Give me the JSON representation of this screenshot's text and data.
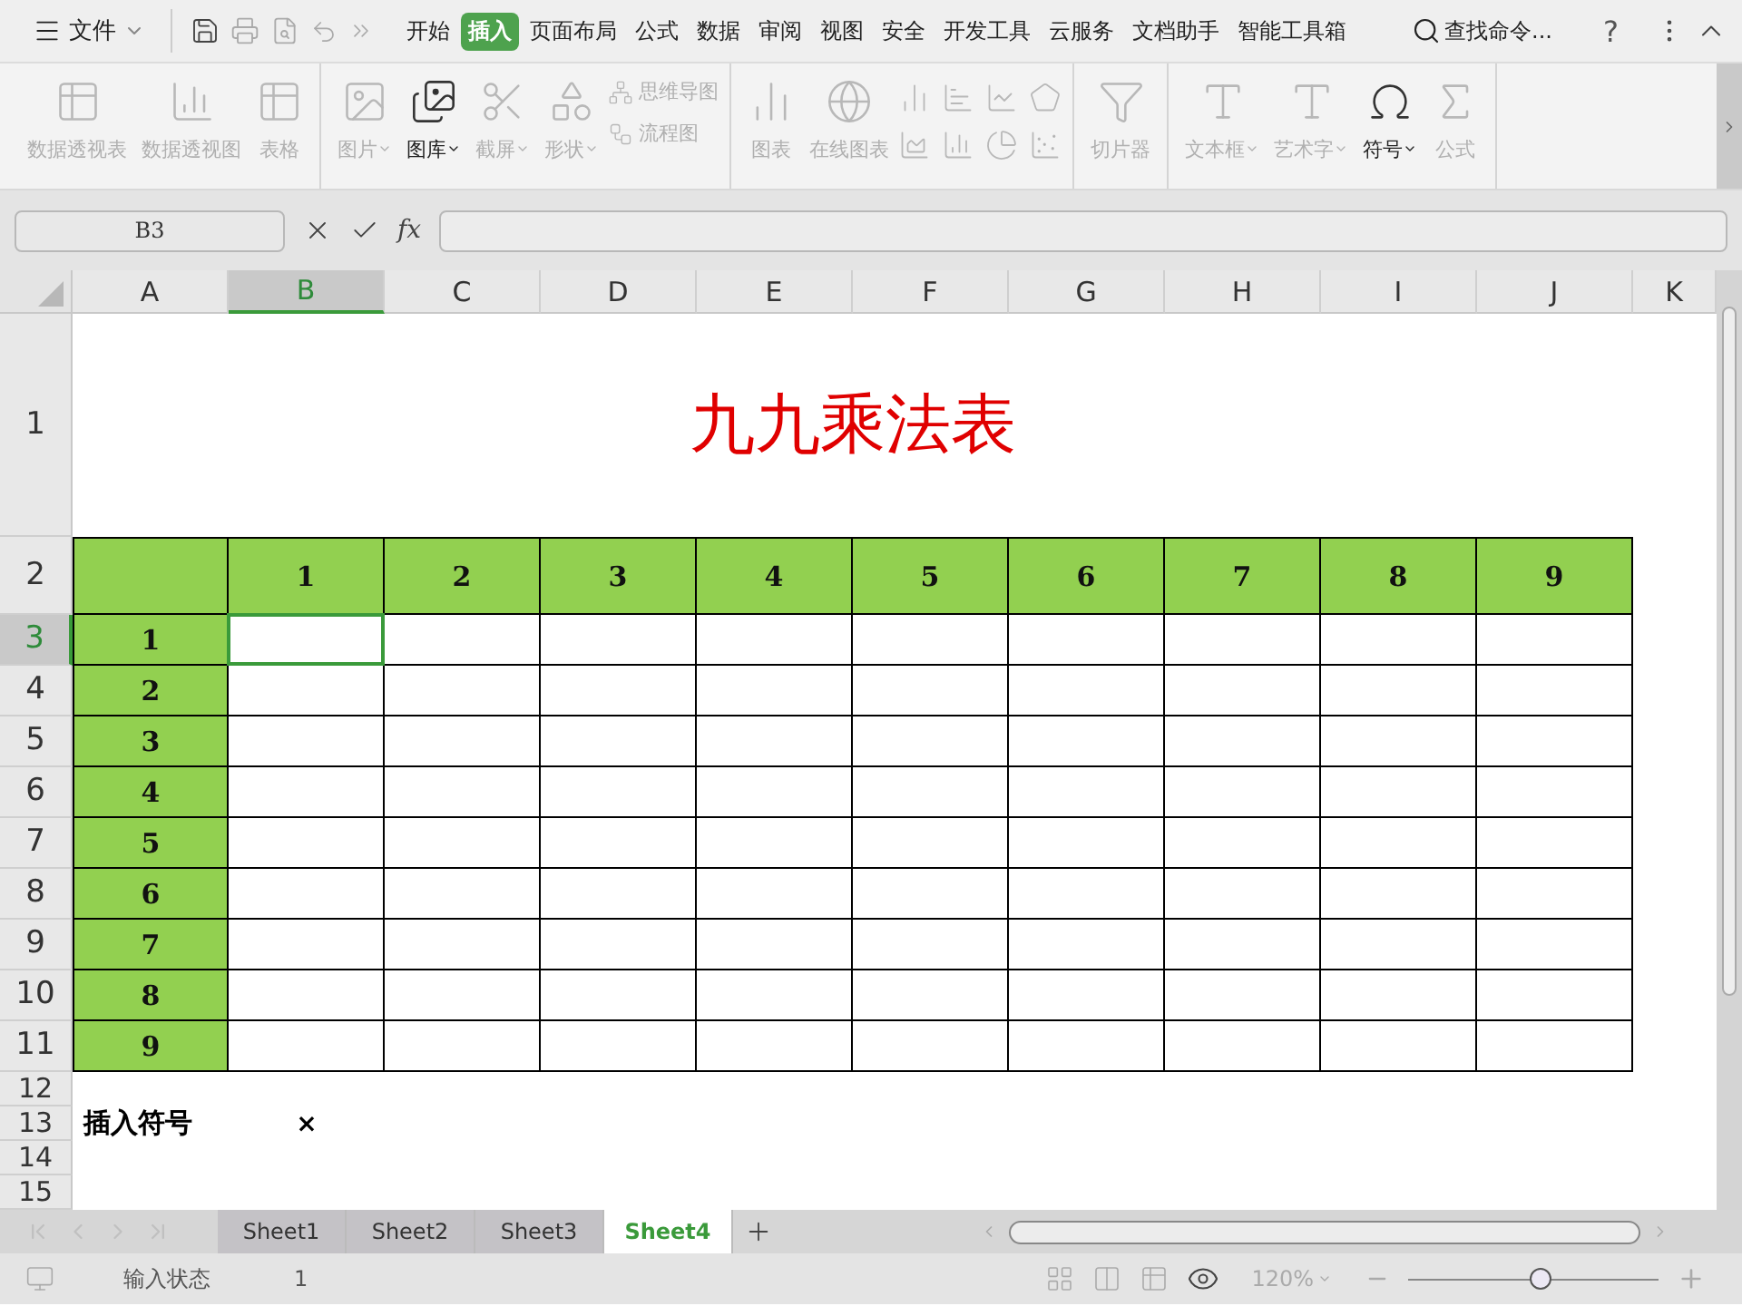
{
  "menu_bar": {
    "file_menu": "文件",
    "tabs": [
      {
        "label": "开始",
        "selected": false
      },
      {
        "label": "插入",
        "selected": true
      },
      {
        "label": "页面布局",
        "selected": false
      },
      {
        "label": "公式",
        "selected": false
      },
      {
        "label": "数据",
        "selected": false
      },
      {
        "label": "审阅",
        "selected": false
      },
      {
        "label": "视图",
        "selected": false
      },
      {
        "label": "安全",
        "selected": false
      },
      {
        "label": "开发工具",
        "selected": false
      },
      {
        "label": "云服务",
        "selected": false
      },
      {
        "label": "文档助手",
        "selected": false
      },
      {
        "label": "智能工具箱",
        "selected": false
      }
    ],
    "search": "查找命令...",
    "help": "?"
  },
  "ribbon": {
    "groups": [
      [
        {
          "kind": "large",
          "label": "数据透视表",
          "disabled": true,
          "dropdown": false
        },
        {
          "kind": "large",
          "label": "数据透视图",
          "disabled": true,
          "dropdown": false
        },
        {
          "kind": "large",
          "label": "表格",
          "disabled": true,
          "dropdown": false
        }
      ],
      [
        {
          "kind": "large",
          "label": "图片",
          "disabled": true,
          "dropdown": true
        },
        {
          "kind": "large",
          "label": "图库",
          "disabled": false,
          "dropdown": true
        },
        {
          "kind": "large",
          "label": "截屏",
          "disabled": true,
          "dropdown": true
        },
        {
          "kind": "large",
          "label": "形状",
          "disabled": true,
          "dropdown": true
        },
        {
          "kind": "small",
          "label": "思维导图",
          "disabled": true
        },
        {
          "kind": "small",
          "label": "流程图",
          "disabled": true
        }
      ],
      [
        {
          "kind": "large",
          "label": "图表",
          "disabled": true,
          "dropdown": false
        },
        {
          "kind": "large",
          "label": "在线图表",
          "disabled": true,
          "dropdown": false
        },
        {
          "kind": "chart-grid",
          "disabled": true
        }
      ],
      [
        {
          "kind": "large",
          "label": "切片器",
          "disabled": true,
          "dropdown": false
        }
      ],
      [
        {
          "kind": "large",
          "label": "文本框",
          "disabled": true,
          "dropdown": true
        },
        {
          "kind": "large",
          "label": "艺术字",
          "disabled": true,
          "dropdown": true
        },
        {
          "kind": "large",
          "label": "符号",
          "disabled": false,
          "dropdown": true
        },
        {
          "kind": "large",
          "label": "公式",
          "disabled": true,
          "dropdown": false
        }
      ]
    ]
  },
  "formula_bar": {
    "cell_ref": "B3",
    "fx": "fx"
  },
  "columns": [
    {
      "label": "A",
      "selected": false
    },
    {
      "label": "B",
      "selected": true
    },
    {
      "label": "C",
      "selected": false
    },
    {
      "label": "D",
      "selected": false
    },
    {
      "label": "E",
      "selected": false
    },
    {
      "label": "F",
      "selected": false
    },
    {
      "label": "G",
      "selected": false
    },
    {
      "label": "H",
      "selected": false
    },
    {
      "label": "I",
      "selected": false
    },
    {
      "label": "J",
      "selected": false
    },
    {
      "label": "K",
      "selected": false
    }
  ],
  "rows": [
    {
      "label": "1",
      "selected": false
    },
    {
      "label": "2",
      "selected": false
    },
    {
      "label": "3",
      "selected": true
    },
    {
      "label": "4",
      "selected": false
    },
    {
      "label": "5",
      "selected": false
    },
    {
      "label": "6",
      "selected": false
    },
    {
      "label": "7",
      "selected": false
    },
    {
      "label": "8",
      "selected": false
    },
    {
      "label": "9",
      "selected": false
    },
    {
      "label": "10",
      "selected": false
    },
    {
      "label": "11",
      "selected": false
    },
    {
      "label": "12",
      "selected": false
    },
    {
      "label": "13",
      "selected": false
    },
    {
      "label": "14",
      "selected": false
    },
    {
      "label": "15",
      "selected": false
    }
  ],
  "sheet": {
    "title": "九九乘法表",
    "header_numbers": [
      "1",
      "2",
      "3",
      "4",
      "5",
      "6",
      "7",
      "8",
      "9"
    ],
    "row_numbers": [
      "1",
      "2",
      "3",
      "4",
      "5",
      "6",
      "7",
      "8",
      "9"
    ],
    "note": "插入符号",
    "symbol": "×"
  },
  "sheet_tabs": [
    {
      "label": "Sheet1",
      "selected": false
    },
    {
      "label": "Sheet2",
      "selected": false
    },
    {
      "label": "Sheet3",
      "selected": false
    },
    {
      "label": "Sheet4",
      "selected": true
    }
  ],
  "status_bar": {
    "mode": "输入状态",
    "value": "1",
    "zoom": "120%",
    "zoom_slider": {
      "level": 0.53
    }
  }
}
